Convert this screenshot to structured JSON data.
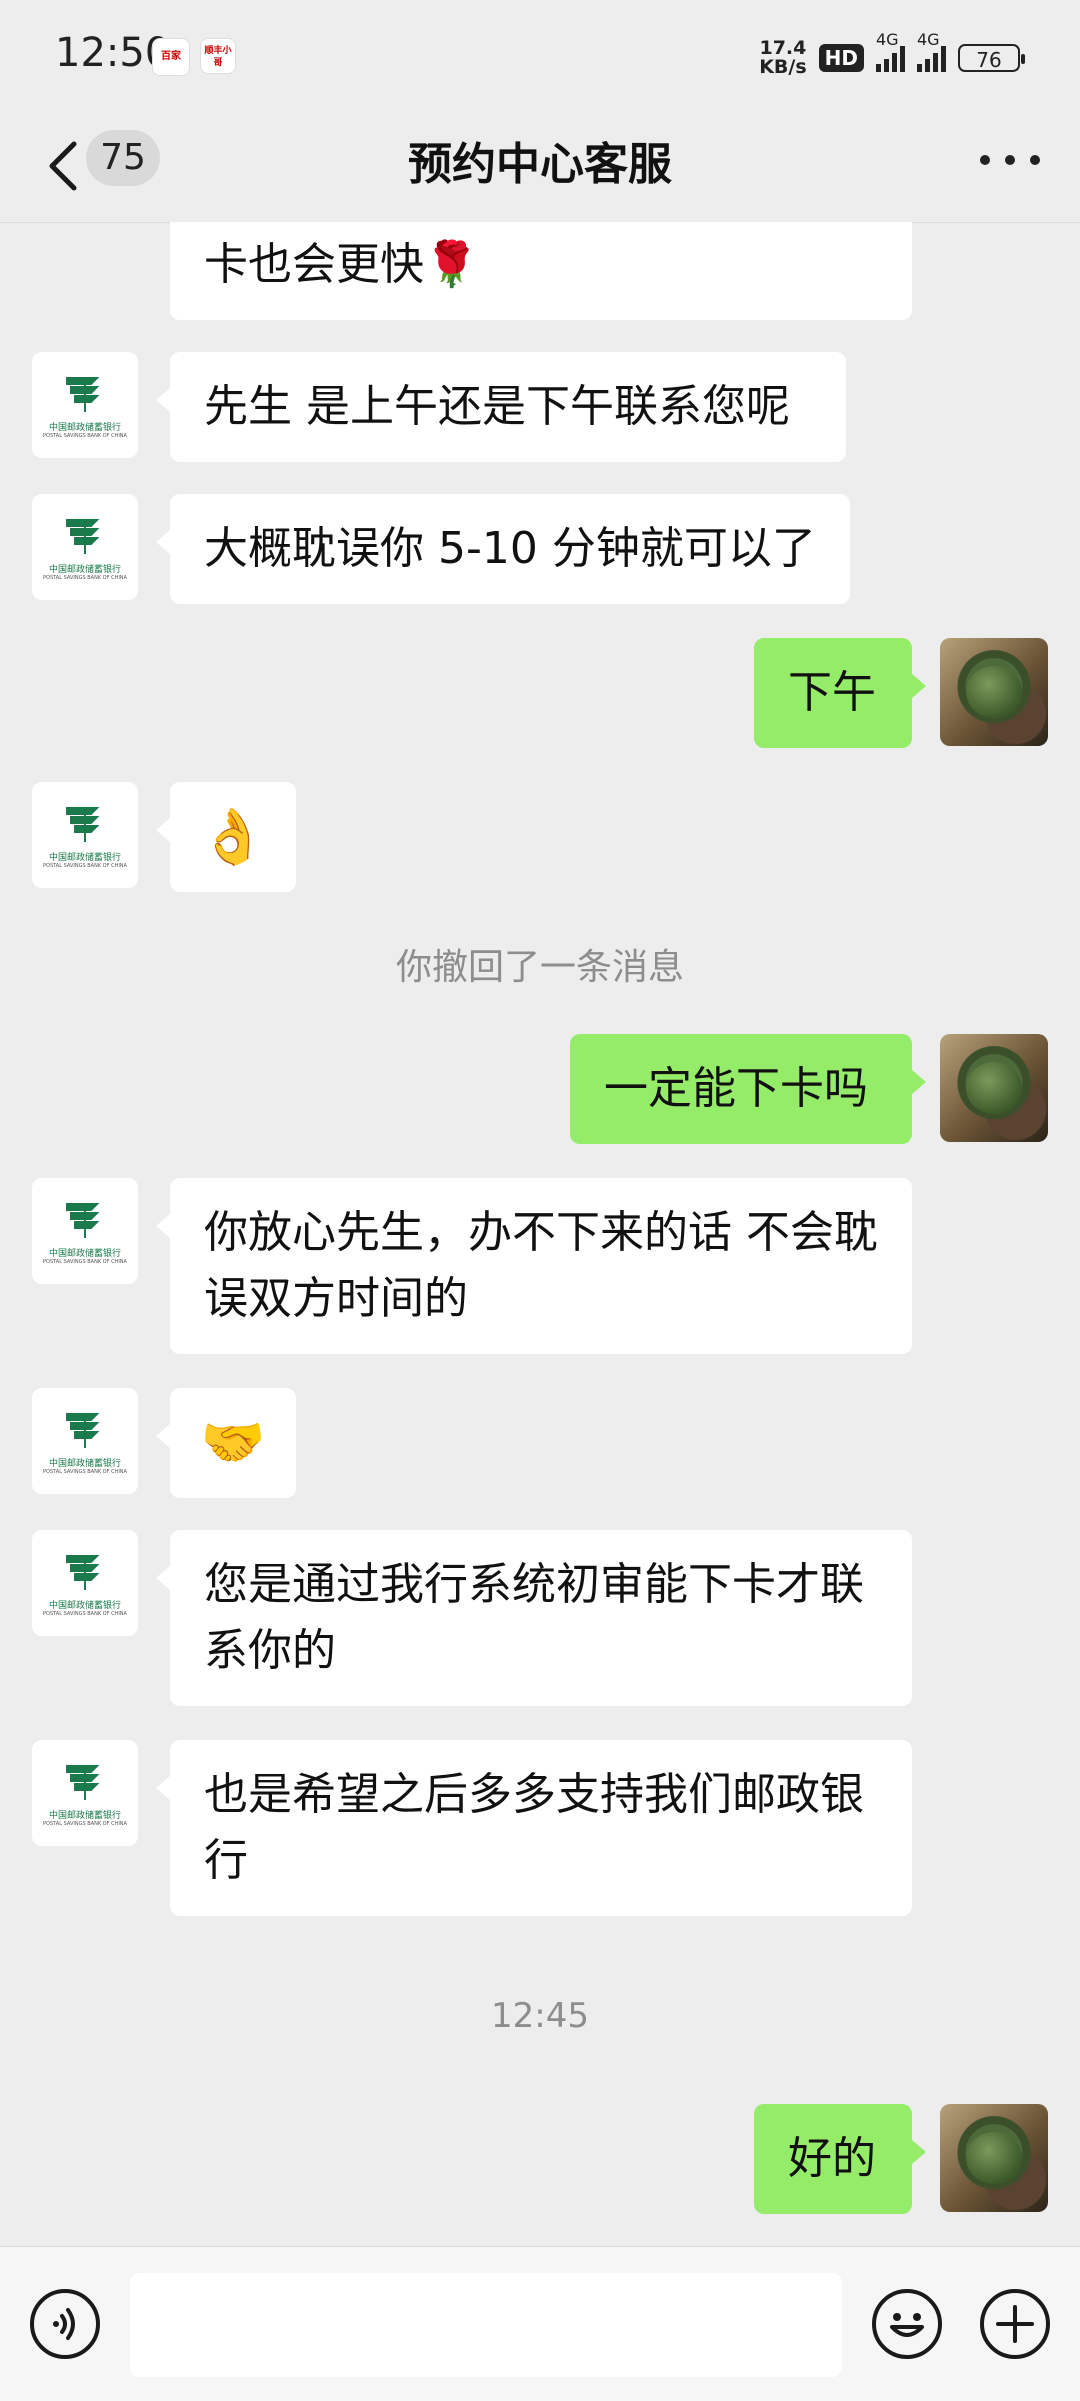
{
  "status_bar": {
    "time": "12:50",
    "app_icons": [
      "百家",
      "顺丰小哥"
    ],
    "net_speed_value": "17.4",
    "net_speed_unit": "KB/s",
    "hd_label": "HD",
    "signal_label_1": "4G",
    "signal_label_2": "4G",
    "battery": "76"
  },
  "header": {
    "unread_count": "75",
    "title": "预约中心客服"
  },
  "bank_avatar_caption": "中国邮政储蓄银行",
  "bank_avatar_caption_en": "POSTAL SAVINGS BANK OF CHINA",
  "messages": [
    {
      "side": "in",
      "text": "卡也会更快🌹"
    },
    {
      "side": "in",
      "text": "先生 是上午还是下午联系您呢"
    },
    {
      "side": "in",
      "text": "大概耽误你 5-10 分钟就可以了"
    },
    {
      "side": "out",
      "text": "下午"
    },
    {
      "side": "in",
      "text": "👌"
    },
    {
      "side": "system",
      "text": "你撤回了一条消息"
    },
    {
      "side": "out",
      "text": "一定能下卡吗"
    },
    {
      "side": "in",
      "text": "你放心先生，办不下来的话 不会耽误双方时间的"
    },
    {
      "side": "in",
      "text": "🤝"
    },
    {
      "side": "in",
      "text": "您是通过我行系统初审能下卡才联系你的"
    },
    {
      "side": "in",
      "text": "也是希望之后多多支持我们邮政银行"
    },
    {
      "side": "system",
      "text": "12:45"
    },
    {
      "side": "out",
      "text": "好的"
    }
  ],
  "input_bar": {
    "placeholder": "",
    "icons": [
      "voice-icon",
      "emoji-icon",
      "plus-icon"
    ]
  },
  "colors": {
    "outgoing_bubble": "#95ec69",
    "incoming_bubble": "#ffffff",
    "background": "#ededed",
    "bank_green": "#1a7a4c"
  }
}
